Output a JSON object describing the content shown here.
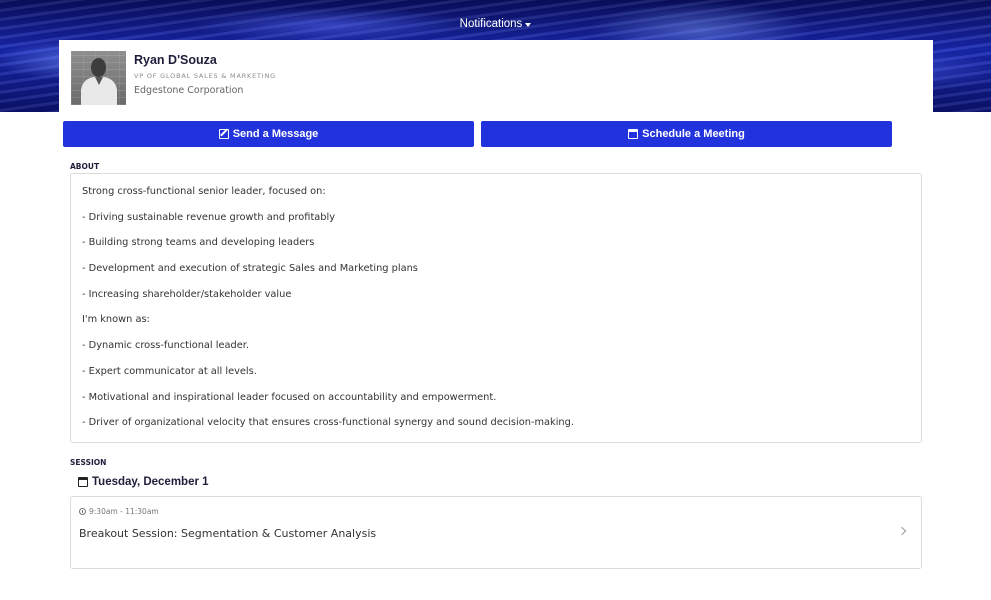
{
  "header": {
    "notifications_label": "Notifications"
  },
  "profile": {
    "name": "Ryan D'Souza",
    "title": "VP OF GLOBAL SALES & MARKETING",
    "company": "Edgestone Corporation"
  },
  "actions": {
    "message_label": "Send a Message",
    "meeting_label": "Schedule a Meeting"
  },
  "about": {
    "label": "ABOUT",
    "lines": [
      "Strong cross-functional senior leader, focused on:",
      "- Driving sustainable revenue growth and profitably",
      "- Building strong teams and developing leaders",
      "- Development and execution of strategic Sales and Marketing plans",
      "- Increasing shareholder/stakeholder value",
      "I'm known as:",
      "- Dynamic cross-functional leader.",
      "- Expert communicator at all levels.",
      "- Motivational and inspirational leader focused on accountability and empowerment.",
      "- Driver of organizational velocity that ensures cross-functional synergy and sound decision-making."
    ]
  },
  "session": {
    "label": "SESSION",
    "date": "Tuesday, December 1",
    "items": [
      {
        "time": "9:30am - 11:30am",
        "title": "Breakout Session: Segmentation & Customer Analysis"
      }
    ]
  },
  "colors": {
    "accent": "#2233dd",
    "banner": "#1a2bb8"
  }
}
